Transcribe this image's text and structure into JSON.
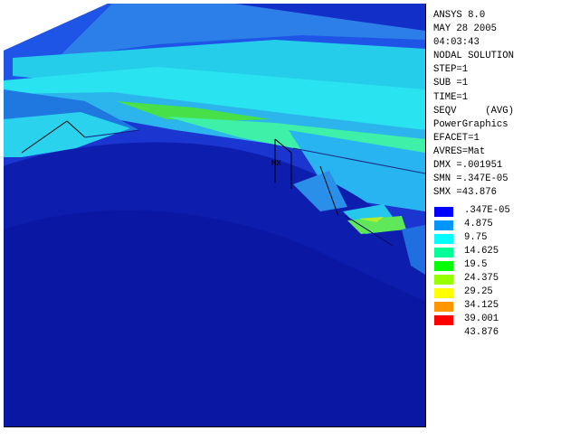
{
  "header_lines": [
    "ANSYS 8.0",
    "MAY 28 2005",
    "04:03:43",
    "NODAL SOLUTION",
    "STEP=1",
    "SUB =1",
    "TIME=1",
    "SEQV     (AVG)",
    "PowerGraphics",
    "EFACET=1",
    "AVRES=Mat",
    "DMX =.001951",
    "SMN =.347E-05",
    "SMX =43.876"
  ],
  "max_marker_label": "MX",
  "legend": {
    "values": [
      ".347E-05",
      "4.875",
      "9.75",
      "14.625",
      "19.5",
      "24.375",
      "29.25",
      "34.125",
      "39.001",
      "43.876"
    ],
    "colors": [
      "#0000ff",
      "#0096ff",
      "#00ffff",
      "#00ff96",
      "#00ff00",
      "#96ff00",
      "#ffff00",
      "#ff9600",
      "#ff0000"
    ]
  },
  "colors": {
    "dark_blue": "#0a1aa8",
    "blue": "#1e3fe0",
    "mid_blue": "#1f7fe0",
    "light_blue": "#2fa8f0",
    "cyan": "#28e8ef",
    "teal": "#2ad5d0",
    "green": "#4ee88a",
    "bright_green": "#47e043",
    "yellow_green": "#b4ee2a"
  }
}
